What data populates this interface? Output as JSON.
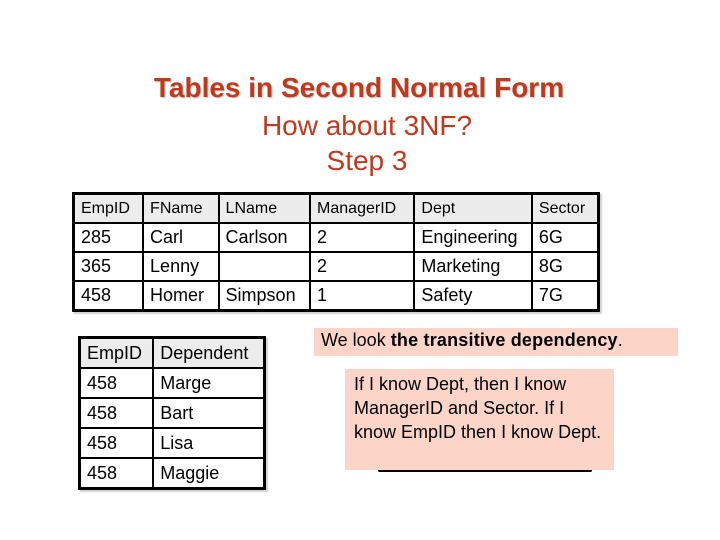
{
  "slide": {
    "title": "Tables in Second Normal Form",
    "subtitle_line1": "How about 3NF?",
    "subtitle_line2": "Step 3",
    "colors": {
      "title": "#c0391b",
      "note_background": "#fdd5c8",
      "table_header_background": "#ececec"
    }
  },
  "employee_table": {
    "headers": [
      "EmpID",
      "FName",
      "LName",
      "ManagerID",
      "Dept",
      "Sector"
    ],
    "rows": [
      [
        "285",
        "Carl",
        "Carlson",
        "2",
        "Engineering",
        "6G"
      ],
      [
        "365",
        "Lenny",
        "",
        "2",
        "Marketing",
        "8G"
      ],
      [
        "458",
        "Homer",
        "Simpson",
        "1",
        "Safety",
        "7G"
      ]
    ]
  },
  "dependent_table": {
    "headers": [
      "EmpID",
      "Dependent"
    ],
    "rows": [
      [
        "458",
        "Marge"
      ],
      [
        "458",
        "Bart"
      ],
      [
        "458",
        "Lisa"
      ],
      [
        "458",
        "Maggie"
      ]
    ]
  },
  "notes": {
    "top_prefix": "We look ",
    "top_bold": "the transitive dependency",
    "top_suffix": ".",
    "body": "If I know Dept, then I know ManagerID and Sector. If I know EmpID then I know Dept."
  }
}
